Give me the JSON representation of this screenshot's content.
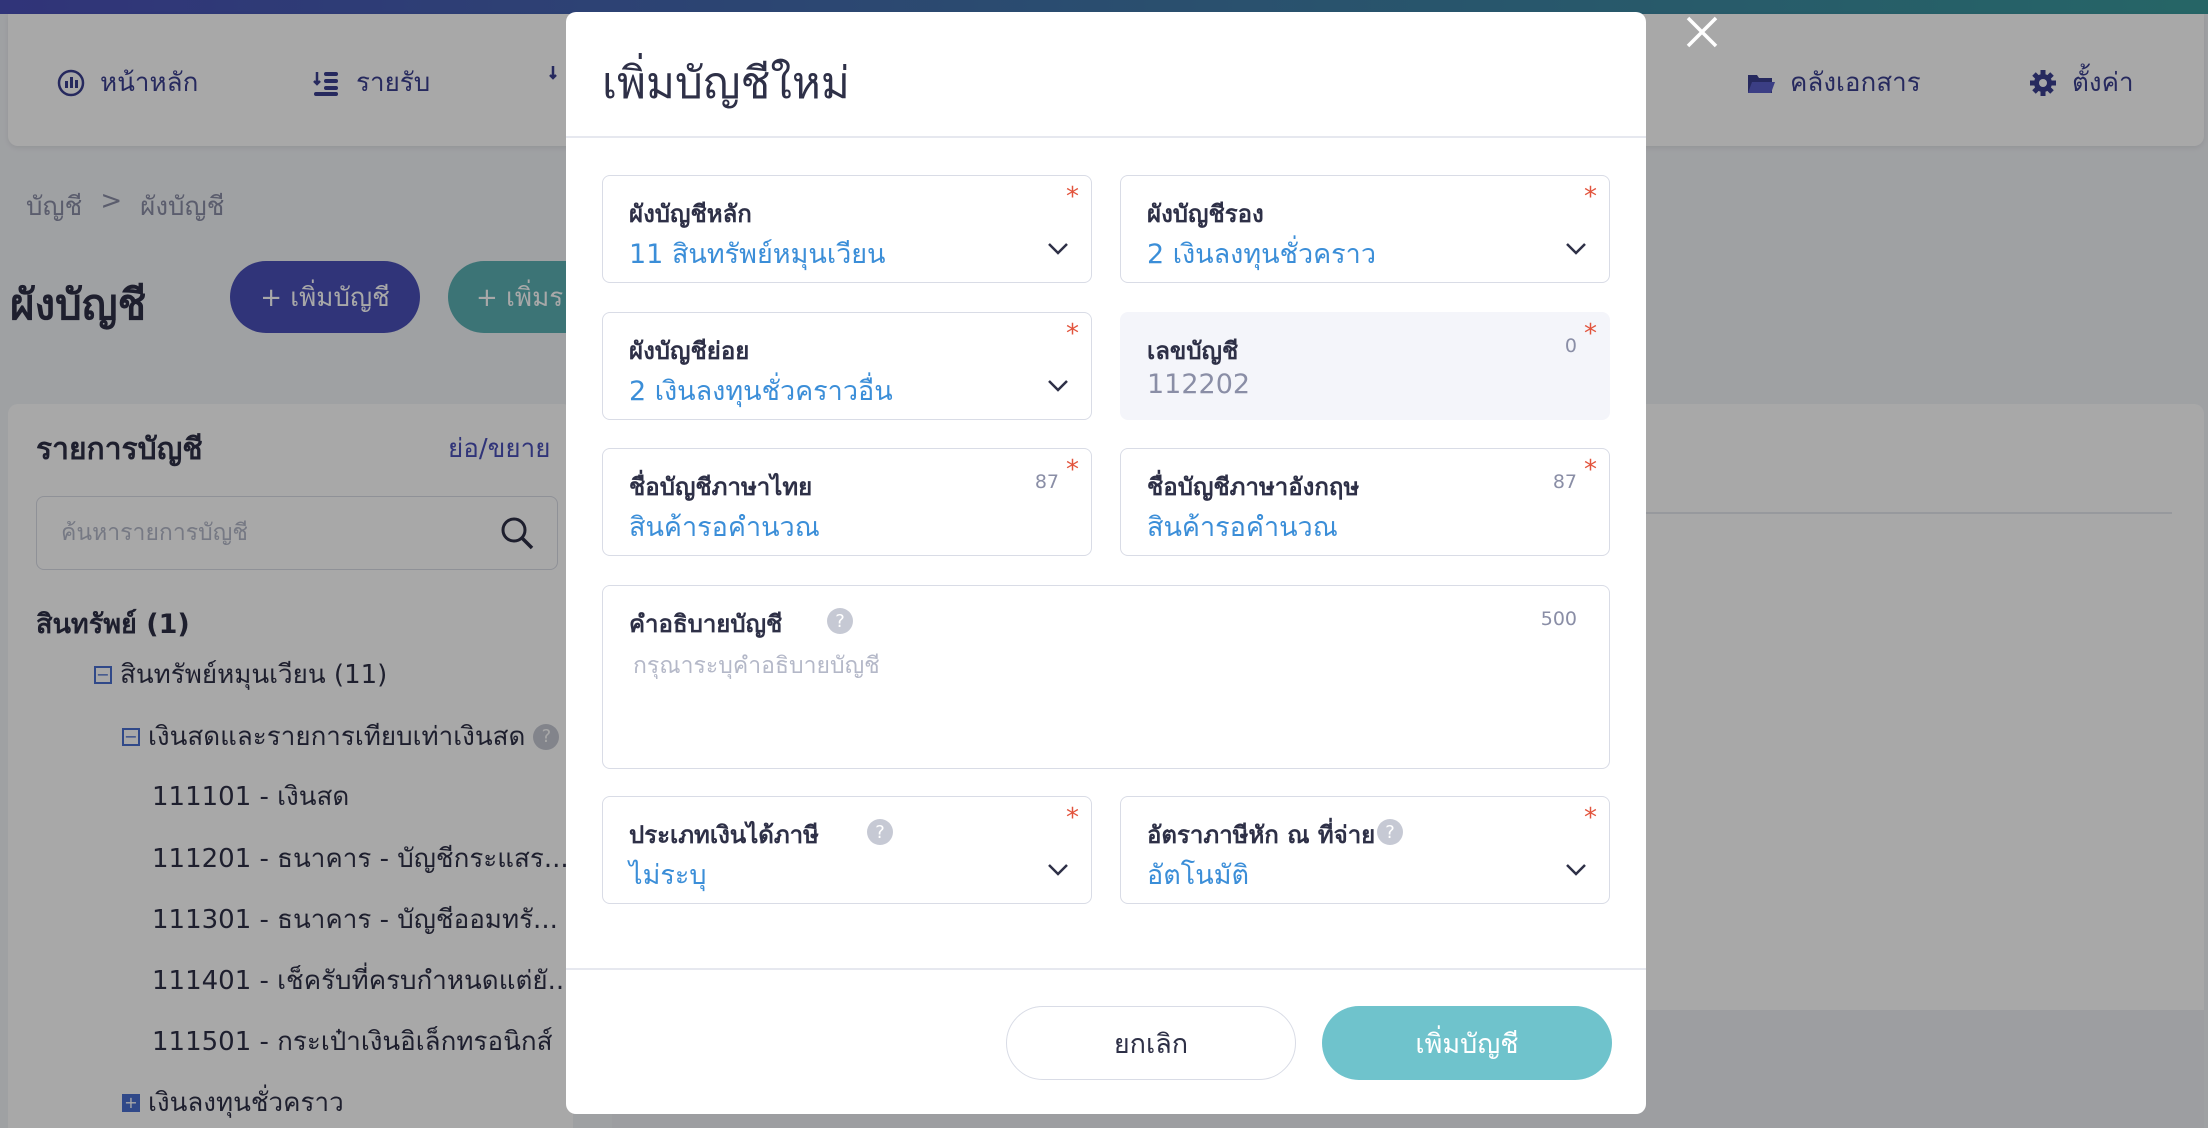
{
  "nav": {
    "items": [
      {
        "label": "หน้าหลัก",
        "icon": "chart-icon"
      },
      {
        "label": "รายรับ",
        "icon": "coins-icon"
      },
      {
        "label": "คลังเอกสาร",
        "icon": "folder-icon"
      },
      {
        "label": "ตั้งค่า",
        "icon": "gear-icon"
      }
    ]
  },
  "breadcrumb": {
    "root": "บัญชี",
    "separator": ">",
    "current": "ผังบัญชี"
  },
  "page": {
    "title": "ผังบัญชี",
    "add_account_label": "+ เพิ่มบัญชี",
    "add_other_label": "+ เพิ่มร"
  },
  "left_panel": {
    "title": "รายการบัญชี",
    "toggle_label": "ย่อ/ขยาย",
    "search_placeholder": "ค้นหารายการบัญชี",
    "tree": {
      "root": "สินทรัพย์ (1)",
      "group": "สินทรัพย์หมุนเวียน (11)",
      "subgroup": "เงินสดและรายการเทียบเท่าเงินสด",
      "accounts": [
        "111101 - เงินสด",
        "111201 - ธนาคาร - บัญชีกระแสร...",
        "111301 - ธนาคาร - บัญชีออมทรั...",
        "111401 - เช็ครับที่ครบกำหนดแต่ยั...",
        "111501 - กระเป๋าเงินอิเล็กทรอนิกส์"
      ],
      "collapsed_group": "เงินลงทุนชั่วคราว"
    }
  },
  "modal": {
    "title": "เพิ่มบัญชีใหม่",
    "fields": {
      "main_chart": {
        "label": "ผังบัญชีหลัก",
        "value": "11 สินทรัพย์หมุนเวียน",
        "required": "*"
      },
      "sub_chart": {
        "label": "ผังบัญชีรอง",
        "value": "2 เงินลงทุนชั่วคราว",
        "required": "*"
      },
      "minor_chart": {
        "label": "ผังบัญชีย่อย",
        "value": "2 เงินลงทุนชั่วคราวอื่น",
        "required": "*"
      },
      "account_number": {
        "label": "เลขบัญชี",
        "value": "112202",
        "count": "0",
        "required": "*"
      },
      "name_th": {
        "label": "ชื่อบัญชีภาษาไทย",
        "value": "สินค้ารอคำนวณ",
        "count": "87",
        "required": "*"
      },
      "name_en": {
        "label": "ชื่อบัญชีภาษาอังกฤษ",
        "value": "สินค้ารอคำนวณ",
        "count": "87",
        "required": "*"
      },
      "description": {
        "label": "คำอธิบายบัญชี",
        "placeholder": "กรุณาระบุคำอธิบายบัญชี",
        "count": "500"
      },
      "income_type": {
        "label": "ประเภทเงินได้ภาษี",
        "value": "ไม่ระบุ",
        "required": "*"
      },
      "withholding_rate": {
        "label": "อัตราภาษีหัก ณ ที่จ่าย",
        "value": "อัตโนมัติ",
        "required": "*"
      }
    },
    "cancel_label": "ยกเลิก",
    "submit_label": "เพิ่มบัญชี"
  },
  "help_glyph": "?"
}
